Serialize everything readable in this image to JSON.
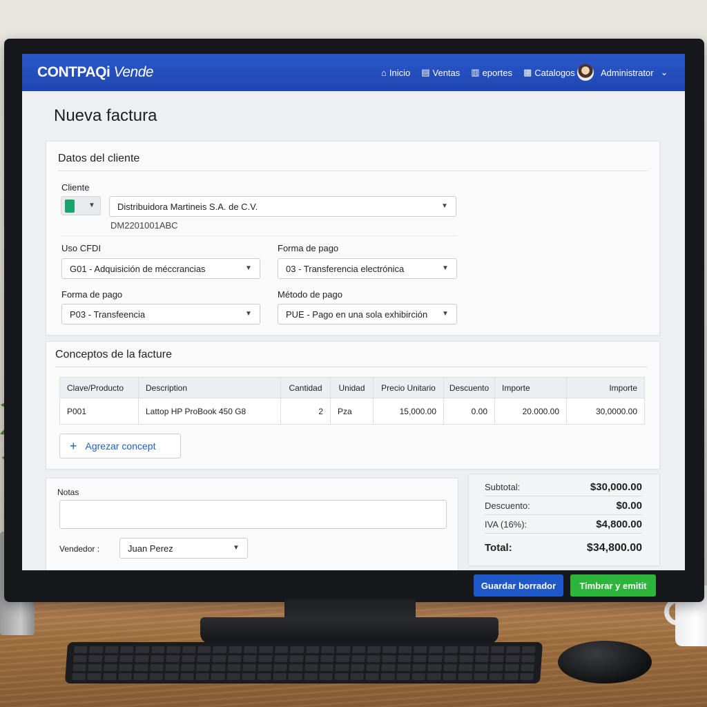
{
  "app": {
    "brand": "CONTPAQi",
    "brand_suffix": "Vende",
    "nav": [
      {
        "label": "Inicio",
        "icon": "home-icon"
      },
      {
        "label": "Ventas",
        "icon": "sales-icon"
      },
      {
        "label": "eportes",
        "icon": "reports-icon"
      },
      {
        "label": "Catalogos",
        "icon": "catalog-icon"
      }
    ],
    "user_name": "Administrator"
  },
  "page": {
    "title": "Nueva factura"
  },
  "cliente_section": {
    "title": "Datos del cliente",
    "cliente_label": "Cliente",
    "cliente_value": "Distribuidora Martineis S.A. de C.V.",
    "rfc": "DM2201001ABC",
    "uso_cfdi_label": "Uso CFDI",
    "uso_cfdi_value": "G01 - Adquisición de méccrancias",
    "forma_pago_label_1": "Forma de pago",
    "forma_pago_value_1": "03 - Transferencia electrónica",
    "forma_pago_label_2": "Forma de pago",
    "forma_pago_value_2": "P03 - Transfeencia",
    "metodo_pago_label": "Método de pago",
    "metodo_pago_value": "PUE - Pago en una sola exhibirción"
  },
  "conceptos": {
    "title": "Conceptos de la facture",
    "columns": [
      "Clave/Producto",
      "Description",
      "Cantidad",
      "Unidad",
      "Precio Unitario",
      "Descuento",
      "Importe",
      "Importe"
    ],
    "rows": [
      [
        "P001",
        "Lattop HP ProBook 450 G8",
        "2",
        "Pza",
        "15,000.00",
        "0.00",
        "20.000.00",
        "30,0000.00"
      ]
    ],
    "add_label": "Agrezar concept"
  },
  "notas": {
    "label": "Notas",
    "value": "",
    "vendedor_label": "Vendedor :",
    "vendedor_value": "Juan Perez"
  },
  "totals": {
    "subtotal_label": "Subtotal:",
    "subtotal_value": "$30,000.00",
    "descuento_label": "Descuento:",
    "descuento_value": "$0.00",
    "iva_label": "IVA (16%):",
    "iva_value": "$4,800.00",
    "total_label": "Total:",
    "total_value": "$34,800.00"
  },
  "actions": {
    "save_label": "Guardar borrador",
    "emit_label": "Timbrar y emitit"
  },
  "colors": {
    "topbar": "#2a57c8",
    "save_button": "#1f58c9",
    "emit_button": "#2db43a",
    "link": "#1f5fbf"
  }
}
